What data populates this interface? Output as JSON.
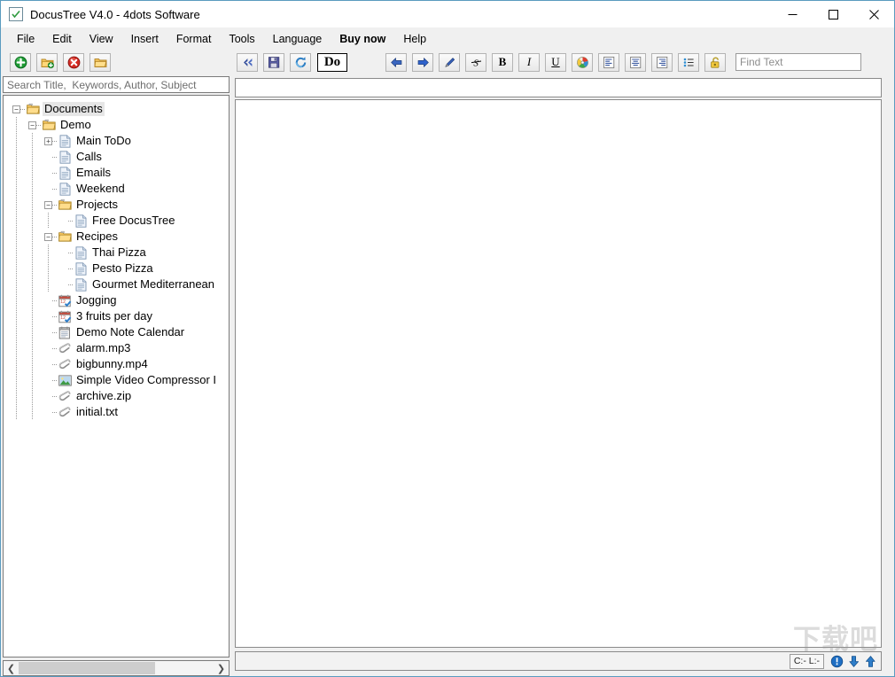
{
  "window": {
    "title": "DocusTree V4.0 - 4dots Software",
    "app_icon": "checkbox-document-icon",
    "controls": {
      "minimize": "minimize-icon",
      "maximize": "maximize-icon",
      "close": "close-icon"
    }
  },
  "menubar": {
    "items": [
      {
        "label": "File",
        "bold": false
      },
      {
        "label": "Edit",
        "bold": false
      },
      {
        "label": "View",
        "bold": false
      },
      {
        "label": "Insert",
        "bold": false
      },
      {
        "label": "Format",
        "bold": false
      },
      {
        "label": "Tools",
        "bold": false
      },
      {
        "label": "Language",
        "bold": false
      },
      {
        "label": "Buy now",
        "bold": true
      },
      {
        "label": "Help",
        "bold": false
      }
    ]
  },
  "toolbar": {
    "left_buttons": [
      {
        "name": "add-node-button",
        "icon": "green-plus-circle-icon"
      },
      {
        "name": "add-folder-button",
        "icon": "folder-add-icon"
      },
      {
        "name": "delete-node-button",
        "icon": "red-delete-circle-icon"
      },
      {
        "name": "open-folder-button",
        "icon": "folder-icon"
      }
    ],
    "mid_buttons": [
      {
        "name": "collapse-all-button",
        "icon": "double-chevron-left-icon"
      },
      {
        "name": "save-button",
        "icon": "floppy-disk-icon"
      },
      {
        "name": "refresh-button",
        "icon": "refresh-icon"
      }
    ],
    "do_label": "Do",
    "format_buttons": [
      {
        "name": "undo-button",
        "icon": "arrow-left-icon"
      },
      {
        "name": "redo-button",
        "icon": "arrow-right-icon"
      },
      {
        "name": "highlight-pen-button",
        "icon": "pen-icon"
      },
      {
        "name": "strikethrough-button",
        "icon": "strikethrough-icon"
      },
      {
        "name": "bold-button",
        "icon": "bold-icon",
        "text": "B"
      },
      {
        "name": "italic-button",
        "icon": "italic-icon",
        "text": "I"
      },
      {
        "name": "underline-button",
        "icon": "underline-icon",
        "text": "U"
      },
      {
        "name": "text-color-button",
        "icon": "color-palette-icon"
      },
      {
        "name": "align-left-button",
        "icon": "align-left-icon"
      },
      {
        "name": "align-center-button",
        "icon": "align-center-icon"
      },
      {
        "name": "align-right-button",
        "icon": "align-right-icon"
      },
      {
        "name": "bullet-list-button",
        "icon": "bullet-list-icon"
      },
      {
        "name": "lock-button",
        "icon": "padlock-icon"
      }
    ],
    "find": {
      "placeholder": "Find Text",
      "value": ""
    }
  },
  "sidebar": {
    "search": {
      "placeholder": "Search Title,  Keywords, Author, Subject",
      "value": ""
    },
    "scrollbar": {
      "left_arrow": "chevron-left-icon",
      "right_arrow": "chevron-right-icon",
      "thumb_percent": 70
    },
    "tree": [
      {
        "label": "Documents",
        "depth": 0,
        "icon": "folder-icon",
        "toggle": "minus",
        "selected": true
      },
      {
        "label": "Demo",
        "depth": 1,
        "icon": "folder-icon",
        "toggle": "minus",
        "selected": false
      },
      {
        "label": "Main ToDo",
        "depth": 2,
        "icon": "document-icon",
        "toggle": "plus",
        "selected": false
      },
      {
        "label": "Calls",
        "depth": 2,
        "icon": "document-icon",
        "toggle": "none",
        "selected": false
      },
      {
        "label": "Emails",
        "depth": 2,
        "icon": "document-icon",
        "toggle": "none",
        "selected": false
      },
      {
        "label": "Weekend",
        "depth": 2,
        "icon": "document-icon",
        "toggle": "none",
        "selected": false
      },
      {
        "label": "Projects",
        "depth": 2,
        "icon": "folder-icon",
        "toggle": "minus",
        "selected": false
      },
      {
        "label": "Free DocusTree",
        "depth": 3,
        "icon": "document-icon",
        "toggle": "none",
        "selected": false
      },
      {
        "label": "Recipes",
        "depth": 2,
        "icon": "folder-icon",
        "toggle": "minus",
        "selected": false
      },
      {
        "label": "Thai Pizza",
        "depth": 3,
        "icon": "document-icon",
        "toggle": "none",
        "selected": false
      },
      {
        "label": "Pesto Pizza",
        "depth": 3,
        "icon": "document-icon",
        "toggle": "none",
        "selected": false
      },
      {
        "label": "Gourmet Mediterranean",
        "depth": 3,
        "icon": "document-icon",
        "toggle": "none",
        "selected": false
      },
      {
        "label": "Jogging",
        "depth": 2,
        "icon": "calendar-icon",
        "toggle": "none",
        "selected": false
      },
      {
        "label": "3 fruits per day",
        "depth": 2,
        "icon": "calendar-icon",
        "toggle": "none",
        "selected": false
      },
      {
        "label": "Demo Note Calendar",
        "depth": 2,
        "icon": "note-calendar-icon",
        "toggle": "none",
        "selected": false
      },
      {
        "label": "alarm.mp3",
        "depth": 2,
        "icon": "attachment-icon",
        "toggle": "none",
        "selected": false
      },
      {
        "label": "bigbunny.mp4",
        "depth": 2,
        "icon": "attachment-icon",
        "toggle": "none",
        "selected": false
      },
      {
        "label": "Simple Video Compressor I",
        "depth": 2,
        "icon": "image-icon",
        "toggle": "none",
        "selected": false
      },
      {
        "label": "archive.zip",
        "depth": 2,
        "icon": "attachment-icon",
        "toggle": "none",
        "selected": false
      },
      {
        "label": "initial.txt",
        "depth": 2,
        "icon": "attachment-icon",
        "toggle": "none",
        "selected": false
      }
    ]
  },
  "editor": {
    "title_value": "",
    "content": ""
  },
  "statusbar": {
    "position_label": "C:- L:-",
    "icons": [
      {
        "name": "info-icon"
      },
      {
        "name": "move-down-icon"
      },
      {
        "name": "move-up-icon"
      }
    ]
  },
  "watermark": {
    "text": "下载吧"
  },
  "colors": {
    "window_border": "#5a9bbf",
    "chrome": "#f0f0f0",
    "selection": "#e6e6e6",
    "folder": "#f5c96b",
    "accent_blue": "#2f5fbf"
  }
}
